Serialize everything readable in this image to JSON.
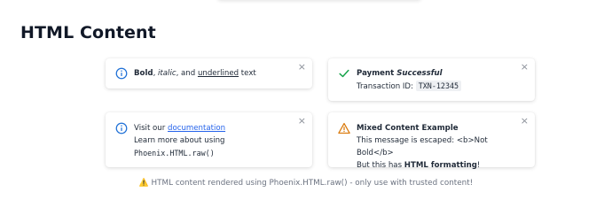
{
  "page": {
    "title": "HTML Content",
    "footer_icon": "warning-emoji",
    "footer_text": "⚠️ HTML content rendered using Phoenix.HTML.raw() - only use with trusted content!"
  },
  "toasts": [
    {
      "type": "info",
      "icon": "info-circle-icon",
      "icon_color": "#1d6fd6",
      "parts": {
        "bold": "Bold",
        "sep1": ", ",
        "italic": "italic",
        "sep2": ", and ",
        "underlined": "underlined",
        "tail": " text"
      },
      "close": "×"
    },
    {
      "type": "success",
      "icon": "check-icon",
      "icon_color": "#16a34a",
      "title_plain": "Payment ",
      "title_italic": "Successful",
      "txn_label": "Transaction ID: ",
      "txn_value": "TXN-12345",
      "close": "×"
    },
    {
      "type": "info",
      "icon": "info-circle-icon",
      "icon_color": "#1d6fd6",
      "visit_prefix": "Visit our ",
      "link_text": "documentation",
      "learn_more": "Learn more about using",
      "code_text": "Phoenix.HTML.raw()",
      "close": "×"
    },
    {
      "type": "warning",
      "icon": "warning-triangle-icon",
      "icon_color": "#d97706",
      "title": "Mixed Content Example",
      "escaped_line": "This message is escaped: <b>Not Bold</b>",
      "formatted_prefix": "But this has ",
      "formatted_bold": "HTML formatting",
      "formatted_suffix": "!",
      "close": "×"
    }
  ]
}
